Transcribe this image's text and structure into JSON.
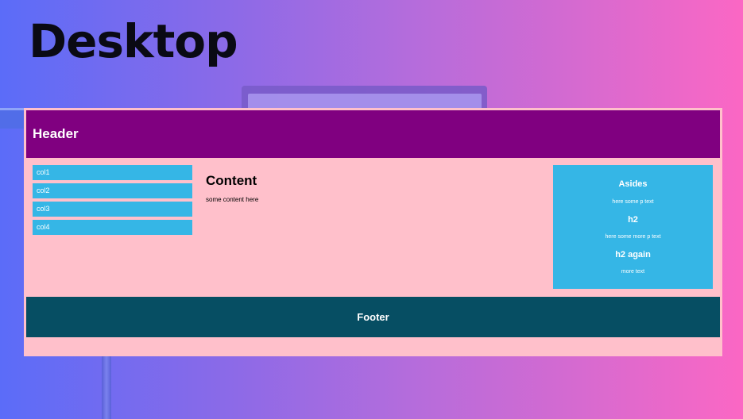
{
  "page": {
    "title": "Desktop"
  },
  "layout": {
    "header": {
      "title": "Header"
    },
    "nav": {
      "items": [
        {
          "label": "col1"
        },
        {
          "label": "col2"
        },
        {
          "label": "col3"
        },
        {
          "label": "col4"
        }
      ]
    },
    "content": {
      "title": "Content",
      "text": "some content here"
    },
    "asides": {
      "title": "Asides",
      "p1": "here some p text",
      "h2": "h2",
      "p2": "here some more p text",
      "h2_again": "h2 again",
      "p3": "more text"
    },
    "footer": {
      "text": "Footer"
    }
  },
  "colors": {
    "header_bg": "#800080",
    "frame_bg": "#ffc0cb",
    "nav_item_bg": "#35b6e6",
    "asides_bg": "#35b6e6",
    "footer_bg": "#064e63"
  }
}
